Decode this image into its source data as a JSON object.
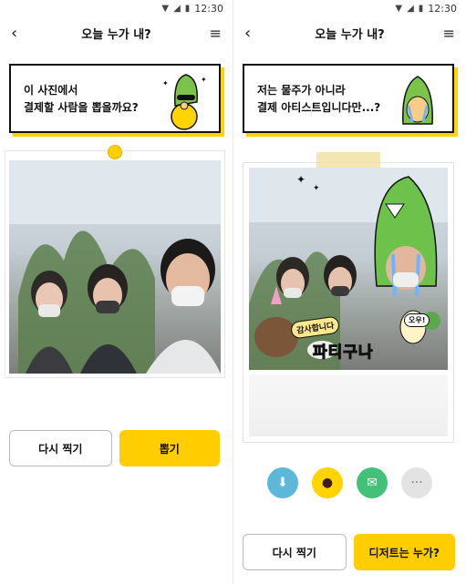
{
  "status": {
    "time": "12:30"
  },
  "left": {
    "header": {
      "title": "오늘 누가 내?"
    },
    "speech": {
      "text": "이 사진에서\n결제할 사람을 뽑을까요?"
    },
    "buttons": {
      "retake": "다시 찍기",
      "pick": "뽑기"
    }
  },
  "right": {
    "header": {
      "title": "오늘 누가 내?"
    },
    "speech": {
      "text": "저는 물주가 아니라\n결제 아티스트입니다만...?"
    },
    "stickers": {
      "party": "파티구나",
      "oyo": "오우!",
      "thanks": "감사합니다"
    },
    "share": [
      "download-icon",
      "kakao-talk-icon",
      "message-icon",
      "more-icon"
    ],
    "buttons": {
      "retake": "다시 찍기",
      "who": "디저트는 누가?"
    }
  },
  "colors": {
    "accent": "#ffcd00",
    "shadow": "#ffd400"
  }
}
